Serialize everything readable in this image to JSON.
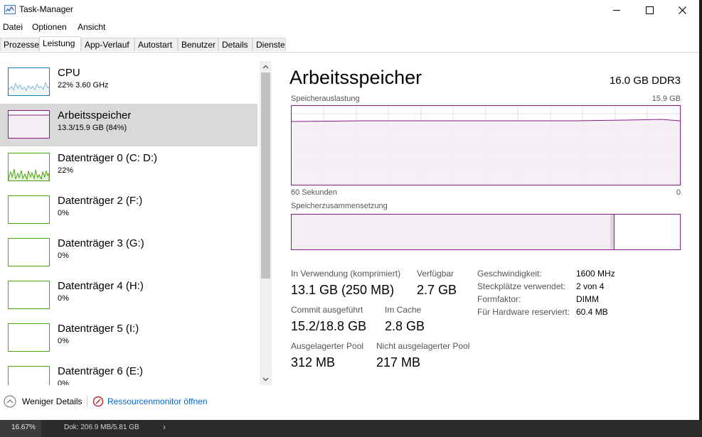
{
  "window": {
    "title": "Task-Manager",
    "buttons": {
      "minimize": "—",
      "maximize": "☐",
      "close": "✕"
    }
  },
  "menu": [
    "Datei",
    "Optionen",
    "Ansicht"
  ],
  "tabs": [
    "Prozesse",
    "Leistung",
    "App-Verlauf",
    "Autostart",
    "Benutzer",
    "Details",
    "Dienste"
  ],
  "active_tab": "Leistung",
  "sidebar": {
    "items": [
      {
        "title": "CPU",
        "sub": "22%  3.60 GHz",
        "color": "#117dbb"
      },
      {
        "title": "Arbeitsspeicher",
        "sub": "13.3/15.9 GB (84%)",
        "color": "#8b1a8b"
      },
      {
        "title": "Datenträger 0 (C: D:)",
        "sub": "22%",
        "color": "#4da60c"
      },
      {
        "title": "Datenträger 2 (F:)",
        "sub": "0%",
        "color": "#4da60c"
      },
      {
        "title": "Datenträger 3 (G:)",
        "sub": "0%",
        "color": "#4da60c"
      },
      {
        "title": "Datenträger 4 (H:)",
        "sub": "0%",
        "color": "#4da60c"
      },
      {
        "title": "Datenträger 5 (I:)",
        "sub": "0%",
        "color": "#4da60c"
      },
      {
        "title": "Datenträger 6 (E:)",
        "sub": "0%",
        "color": "#4da60c"
      }
    ],
    "selected_index": 1
  },
  "main": {
    "title": "Arbeitsspeicher",
    "spec": "16.0 GB DDR3",
    "graph_label": "Speicherauslastung",
    "graph_max": "15.9 GB",
    "graph_left": "60 Sekunden",
    "graph_right": "0",
    "composition_label": "Speicherzusammensetzung",
    "composition_in_use_fraction": 0.82,
    "composition_modified_fraction": 0.01,
    "stats": {
      "in_use_label": "In Verwendung (komprimiert)",
      "in_use_value": "13.1 GB (250 MB)",
      "available_label": "Verfügbar",
      "available_value": "2.7 GB",
      "commit_label": "Commit ausgeführt",
      "commit_value": "15.2/18.8 GB",
      "cache_label": "Im Cache",
      "cache_value": "2.8 GB",
      "paged_label": "Ausgelagerter Pool",
      "paged_value": "312 MB",
      "nonpaged_label": "Nicht ausgelagerter Pool",
      "nonpaged_value": "217 MB"
    },
    "details": [
      {
        "label": "Geschwindigkeit:",
        "value": "1600 MHz"
      },
      {
        "label": "Steckplätze verwendet:",
        "value": "2 von 4"
      },
      {
        "label": "Formfaktor:",
        "value": "DIMM"
      },
      {
        "label": "Für Hardware reserviert:",
        "value": "60.4 MB"
      }
    ]
  },
  "footer": {
    "fewer_details": "Weniger Details",
    "resource_monitor": "Ressourcenmonitor öffnen"
  },
  "taskbar": {
    "left": "16.67%",
    "middle": "Dok: 206.9 MB/5.81 GB"
  },
  "colors": {
    "memory": "#8b1a8b",
    "cpu": "#117dbb",
    "disk": "#4da60c",
    "link": "#0066cc"
  }
}
